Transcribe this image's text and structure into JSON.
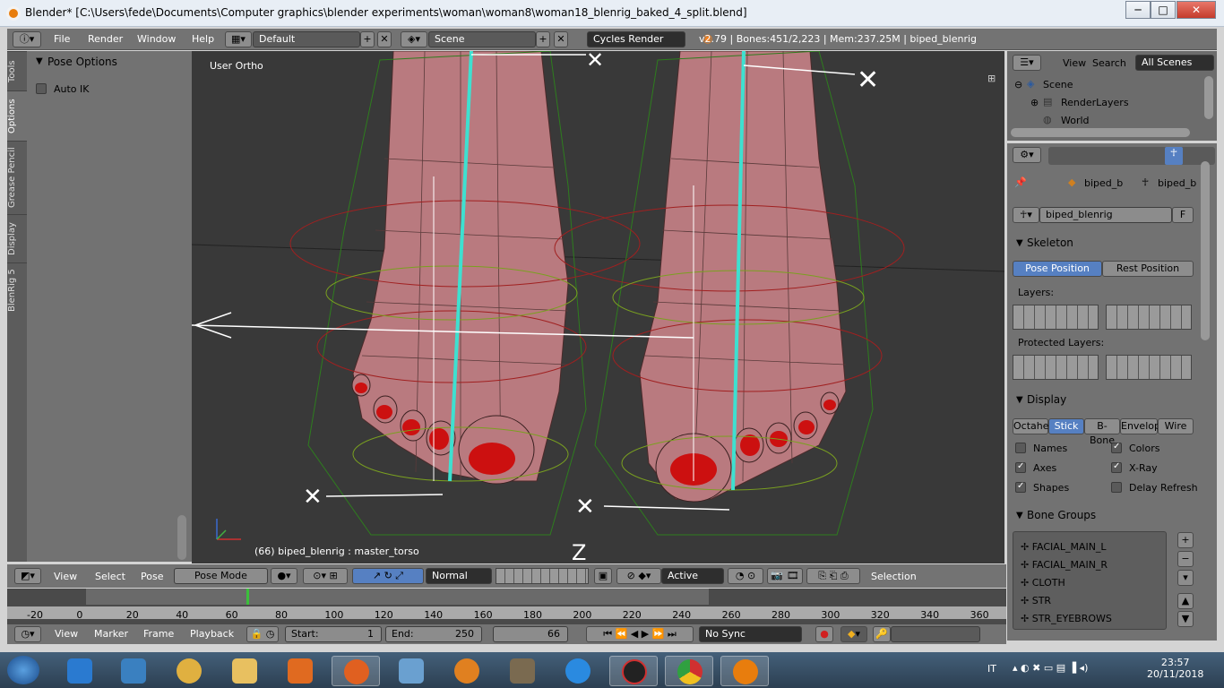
{
  "window": {
    "title": "Blender* [C:\\Users\\fede\\Documents\\Computer graphics\\blender experiments\\woman\\woman8\\woman18_blenrig_baked_4_split.blend]",
    "min_glyph": "─",
    "max_glyph": "□",
    "close_glyph": "✕"
  },
  "menubar": {
    "items": [
      "File",
      "Render",
      "Window",
      "Help"
    ],
    "layout": "Default",
    "scene": "Scene",
    "engine": "Cycles Render",
    "info": "v2.79 | Bones:451/2,223 | Mem:237.25M | biped_blenrig"
  },
  "tool_shelf": {
    "tabs": [
      "Tools",
      "Options",
      "Grease Pencil",
      "Display",
      "BlenRig 5"
    ],
    "panel_title": "Pose Options",
    "auto_ik": "Auto IK"
  },
  "viewport": {
    "view_label": "User Ortho",
    "status": "(66) biped_blenrig : master_torso"
  },
  "outliner": {
    "view": "View",
    "search": "Search",
    "filter": "All Scenes",
    "items": [
      "Scene",
      "RenderLayers",
      "World"
    ]
  },
  "properties": {
    "breadcrumb1": "biped_b",
    "breadcrumb2": "biped_b",
    "datablock": "biped_blenrig",
    "fake_user": "F",
    "skeleton": {
      "title": "Skeleton",
      "pose_position": "Pose Position",
      "rest_position": "Rest Position",
      "layers_label": "Layers:",
      "protected_label": "Protected Layers:"
    },
    "display": {
      "title": "Display",
      "modes": [
        "Octahe",
        "Stick",
        "B-Bone",
        "Envelop",
        "Wire"
      ],
      "active_mode": "Stick",
      "options": [
        {
          "label": "Names",
          "on": false
        },
        {
          "label": "Colors",
          "on": true
        },
        {
          "label": "Axes",
          "on": true
        },
        {
          "label": "X-Ray",
          "on": true
        },
        {
          "label": "Shapes",
          "on": true
        },
        {
          "label": "Delay Refresh",
          "on": false
        }
      ]
    },
    "bone_groups": {
      "title": "Bone Groups",
      "items": [
        "FACIAL_MAIN_L",
        "FACIAL_MAIN_R",
        "CLOTH",
        "STR",
        "STR_EYEBROWS"
      ]
    }
  },
  "viewport_header": {
    "view": "View",
    "select": "Select",
    "pose": "Pose",
    "mode": "Pose Mode",
    "orientation": "Normal",
    "pivot": "Active",
    "selection": "Selection"
  },
  "timeline": {
    "ticks": [
      "-20",
      "0",
      "20",
      "40",
      "60",
      "80",
      "100",
      "120",
      "140",
      "160",
      "180",
      "200",
      "220",
      "240",
      "260",
      "280",
      "300",
      "320",
      "340",
      "360"
    ],
    "current_frame_value": 66
  },
  "timeline_header": {
    "view": "View",
    "marker": "Marker",
    "frame": "Frame",
    "playback": "Playback",
    "start_label": "Start:",
    "start": "1",
    "end_label": "End:",
    "end": "250",
    "current": "66",
    "sync": "No Sync"
  },
  "taskbar": {
    "lang": "IT",
    "time": "23:57",
    "date": "20/11/2018",
    "apps": [
      "internet-explorer",
      "media-player",
      "paint",
      "file-explorer",
      "office",
      "firefox",
      "photo-gallery",
      "settings-wheel",
      "gimp",
      "ccleaner",
      "media-app",
      "chrome",
      "blender"
    ]
  },
  "colors": {
    "blender_bg": "#393939",
    "panel": "#727272",
    "active_blue": "#5680c2",
    "bone_cyan": "#3ee0d0",
    "skin": "#b97a7f",
    "nail_red": "#cc1010"
  }
}
